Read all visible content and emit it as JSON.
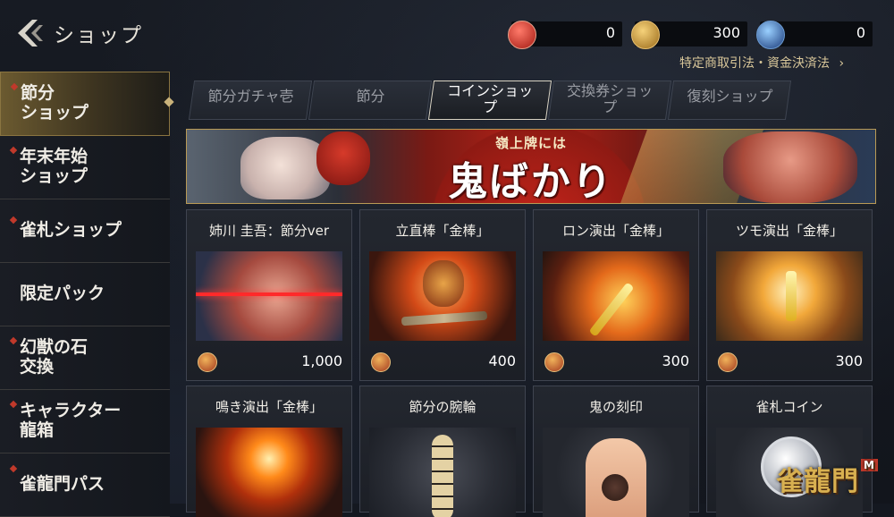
{
  "header": {
    "title": "ショップ",
    "legal_link": "特定商取引法・資金決済法",
    "currencies": [
      {
        "icon": "red-gem-icon",
        "value": "0"
      },
      {
        "icon": "gold-coin-icon",
        "value": "300"
      },
      {
        "icon": "blue-orb-icon",
        "value": "0"
      }
    ]
  },
  "sidebar": {
    "items": [
      {
        "label": "節分\nショップ",
        "active": true
      },
      {
        "label": "年末年始\nショップ"
      },
      {
        "label": "雀札ショップ"
      },
      {
        "label": "限定パック"
      },
      {
        "label": "幻獣の石\n交換"
      },
      {
        "label": "キャラクター\n龍箱"
      },
      {
        "label": "雀龍門パス"
      }
    ]
  },
  "tabs": [
    {
      "label": "節分ガチャ壱"
    },
    {
      "label": "節分"
    },
    {
      "label": "コインショッ\nプ",
      "active": true
    },
    {
      "label": "交換券ショッ\nプ"
    },
    {
      "label": "復刻ショップ"
    }
  ],
  "banner": {
    "sub": "嶺上牌には",
    "main": "鬼ばかり"
  },
  "products": [
    {
      "name": "姉川 圭吾：節分ver",
      "price": "1,000"
    },
    {
      "name": "立直棒「金棒」",
      "price": "400"
    },
    {
      "name": "ロン演出「金棒」",
      "price": "300"
    },
    {
      "name": "ツモ演出「金棒」",
      "price": "300"
    },
    {
      "name": "鳴き演出「金棒」"
    },
    {
      "name": "節分の腕輪"
    },
    {
      "name": "鬼の刻印"
    },
    {
      "name": "雀札コイン"
    }
  ],
  "watermark": {
    "text": "雀龍門",
    "badge": "M"
  },
  "colors": {
    "accent_gold": "#c9b27a",
    "accent_red": "#c0392b",
    "background": "#141820"
  }
}
